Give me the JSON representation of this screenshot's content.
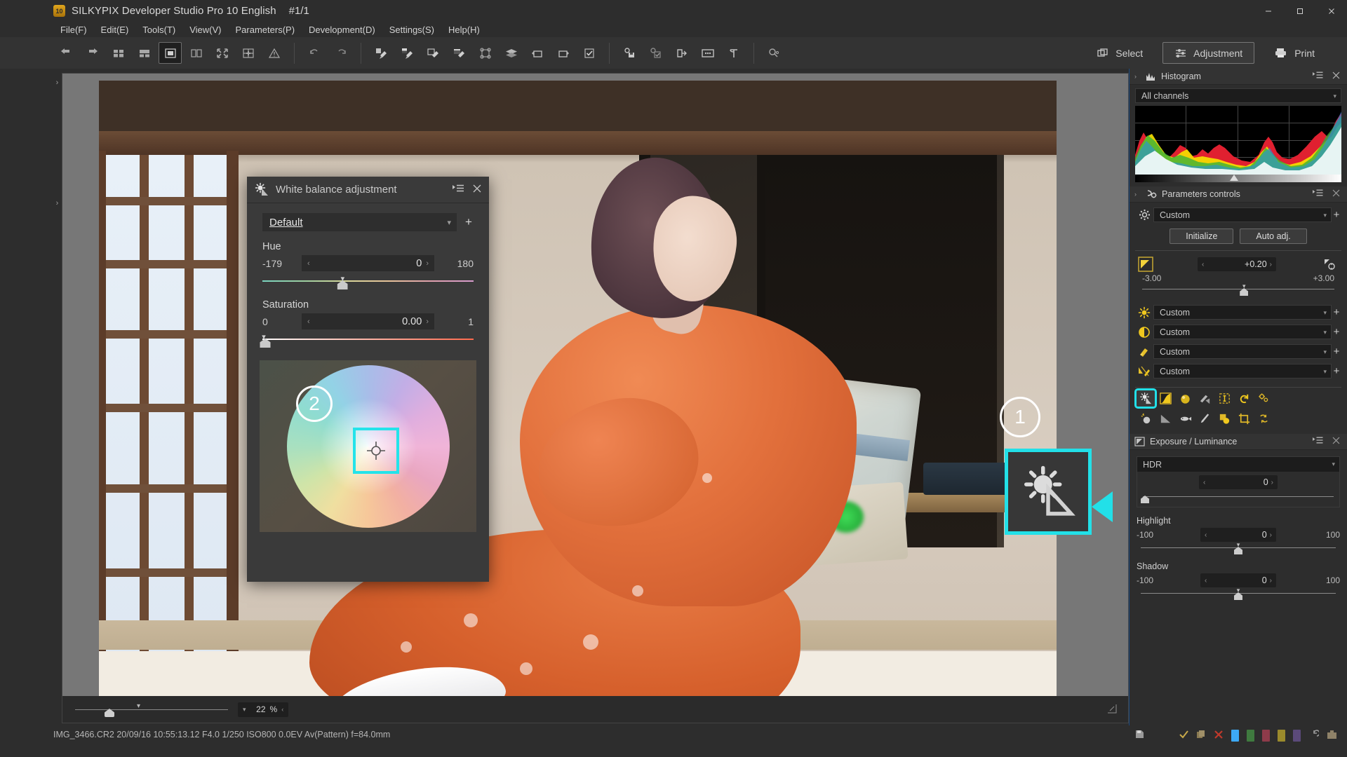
{
  "window": {
    "title": "SILKYPIX Developer Studio Pro 10 English",
    "index": "#1/1",
    "badge": "10",
    "controls": {
      "minimize": "minimize-window",
      "maximize": "maximize-window",
      "close": "close-window"
    }
  },
  "menubar": {
    "items": [
      {
        "label": "File(F)"
      },
      {
        "label": "Edit(E)"
      },
      {
        "label": "Tools(T)"
      },
      {
        "label": "View(V)"
      },
      {
        "label": "Parameters(P)"
      },
      {
        "label": "Development(D)"
      },
      {
        "label": "Settings(S)"
      },
      {
        "label": "Help(H)"
      }
    ]
  },
  "toolbar": {
    "group1": [
      {
        "name": "back-arrow-icon"
      },
      {
        "name": "forward-arrow-icon"
      },
      {
        "name": "thumbnail-grid-icon"
      },
      {
        "name": "filmstrip-view-icon"
      },
      {
        "name": "single-view-icon"
      },
      {
        "name": "dual-view-icon"
      },
      {
        "name": "fullscreen-icon"
      },
      {
        "name": "compare-grid-icon"
      },
      {
        "name": "warning-icon"
      }
    ],
    "group2": [
      {
        "name": "undo-icon"
      },
      {
        "name": "redo-icon"
      }
    ],
    "group3": [
      {
        "name": "copy-parameters-icon"
      },
      {
        "name": "paste-parameters-icon"
      },
      {
        "name": "edit-parameters-icon"
      },
      {
        "name": "batch-parameters-icon"
      },
      {
        "name": "shape-nodes-icon"
      },
      {
        "name": "layers-icon"
      },
      {
        "name": "rotate-left-icon"
      },
      {
        "name": "rotate-right-icon"
      },
      {
        "name": "checkbox-mark-icon"
      }
    ],
    "group4": [
      {
        "name": "save-settings-icon"
      },
      {
        "name": "apply-settings-icon"
      },
      {
        "name": "export-icon"
      },
      {
        "name": "slideshow-icon"
      },
      {
        "name": "hammer-tool-icon"
      }
    ],
    "group5": [
      {
        "name": "search-user-icon"
      }
    ],
    "modes": [
      {
        "label": "Select",
        "icon": "select-icon",
        "active": false
      },
      {
        "label": "Adjustment",
        "icon": "sliders-icon",
        "active": true
      },
      {
        "label": "Print",
        "icon": "printer-icon",
        "active": false
      }
    ]
  },
  "viewer": {
    "zoom_value": "22",
    "zoom_unit": "%",
    "chevron_left_top": "›",
    "chevron_left_mid": "›"
  },
  "white_balance_dialog": {
    "title": "White balance adjustment",
    "icon": "white-balance-icon",
    "menu_icon": "panel-menu-icon",
    "close_icon": "close-icon",
    "preset": {
      "value": "Default",
      "add_label": "+"
    },
    "hue": {
      "label": "Hue",
      "min": "-179",
      "value": "0",
      "max": "180"
    },
    "saturation": {
      "label": "Saturation",
      "min": "0",
      "value": "0.00",
      "max": "1"
    },
    "callout": "2"
  },
  "callouts": {
    "one": "1",
    "two": "2"
  },
  "sidebar": {
    "histogram": {
      "title": "Histogram",
      "icon": "histogram-icon",
      "menu_icon": "panel-menu-icon",
      "close_icon": "close-icon",
      "channel_select": "All channels"
    },
    "parameters_controls": {
      "title": "Parameters controls",
      "icon": "parameters-icon",
      "menu_icon": "panel-menu-icon",
      "close_icon": "close-icon",
      "preset": "Custom",
      "gear_icon": "gear-icon",
      "initialize_label": "Initialize",
      "auto_adj_label": "Auto adj.",
      "exposure": {
        "icon": "exposure-bias-icon",
        "value": "+0.20",
        "min": "-3.00",
        "max": "+3.00",
        "reset_icon": "reset-exposure-icon"
      },
      "rows": [
        {
          "icon": "white-balance-sun-icon",
          "value": "Custom"
        },
        {
          "icon": "tone-contrast-icon",
          "value": "Custom"
        },
        {
          "icon": "color-tone-icon",
          "value": "Custom"
        },
        {
          "icon": "sharpness-icon",
          "value": "Custom"
        }
      ],
      "tool_row_1": [
        {
          "name": "white-balance-tool-icon",
          "selected": true
        },
        {
          "name": "tone-curve-tool-icon",
          "selected": false
        },
        {
          "name": "color-sphere-tool-icon",
          "selected": false
        },
        {
          "name": "gradation-tool-icon",
          "selected": false
        },
        {
          "name": "lens-aberration-tool-icon",
          "selected": false
        },
        {
          "name": "rotate-reset-tool-icon",
          "selected": false
        },
        {
          "name": "effects-tool-icon",
          "selected": false
        }
      ],
      "tool_row_2": [
        {
          "name": "dodge-burn-tool-icon",
          "selected": false
        },
        {
          "name": "gradient-tool-icon",
          "selected": false
        },
        {
          "name": "fisheye-tool-icon",
          "selected": false
        },
        {
          "name": "brush-tool-icon",
          "selected": false
        },
        {
          "name": "color-layer-tool-icon",
          "selected": false
        },
        {
          "name": "crop-tool-icon",
          "selected": false
        },
        {
          "name": "transform-tool-icon",
          "selected": false
        }
      ]
    },
    "exposure_luminance": {
      "title": "Exposure / Luminance",
      "icon": "exposure-panel-icon",
      "menu_icon": "panel-menu-icon",
      "close_icon": "close-icon",
      "hdr": {
        "label": "HDR",
        "value": "0"
      },
      "highlight": {
        "label": "Highlight",
        "min": "-100",
        "value": "0",
        "max": "100"
      },
      "shadow": {
        "label": "Shadow",
        "min": "-100",
        "value": "0",
        "max": "100"
      }
    }
  },
  "statusbar": {
    "text": "IMG_3466.CR2 20/09/16 10:55:13.12 F4.0 1/250 ISO800  0.0EV Av(Pattern) f=84.0mm",
    "icons": [
      {
        "name": "save-state-icon",
        "color": "#b9b9b9"
      },
      {
        "name": "check-mark-icon",
        "color": "#c8a94a"
      },
      {
        "name": "copy-flag-icon",
        "color": "#8a7a52"
      },
      {
        "name": "delete-mark-icon",
        "color": "#c0392b"
      },
      {
        "name": "rating-blue-icon",
        "color": "#3da9f5"
      },
      {
        "name": "rating-green-icon",
        "color": "#3f7a3f"
      },
      {
        "name": "rating-red-icon",
        "color": "#8e3b4a"
      },
      {
        "name": "rating-yellow-icon",
        "color": "#9a8a2c"
      },
      {
        "name": "rating-purple-icon",
        "color": "#5b4a7a"
      },
      {
        "name": "undo-state-icon",
        "color": "#9a9a9a"
      },
      {
        "name": "archive-icon",
        "color": "#8f8268"
      }
    ]
  },
  "colors": {
    "accent_cyan": "#22e0e8",
    "panel_bg": "#2d2d2d",
    "panel_head": "#333333",
    "field_bg": "#1c1c1c",
    "text": "#cfcfcf",
    "border_blue": "#1b4a80"
  }
}
